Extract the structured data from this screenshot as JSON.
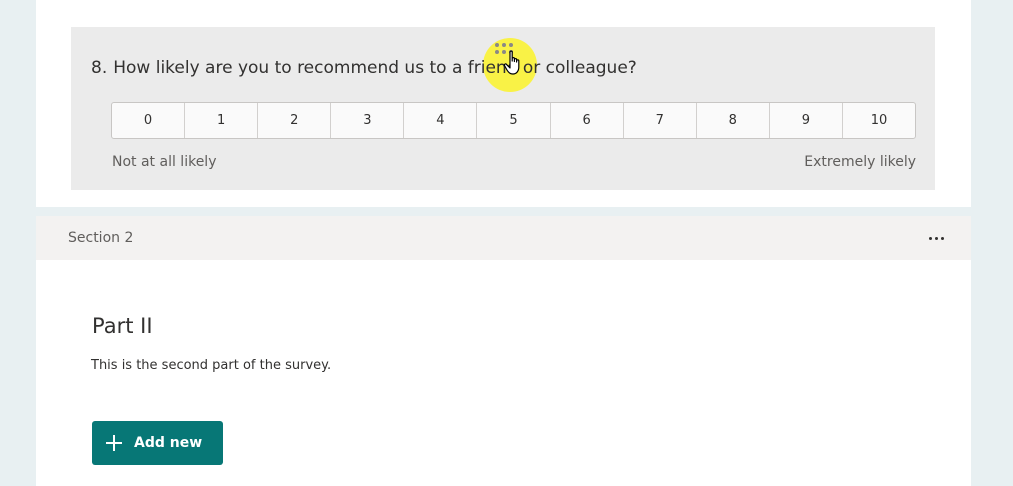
{
  "question": {
    "number": "8.",
    "text": "How likely are you to recommend us to a friend or colleague?",
    "scale": [
      "0",
      "1",
      "2",
      "3",
      "4",
      "5",
      "6",
      "7",
      "8",
      "9",
      "10"
    ],
    "low_label": "Not at all likely",
    "high_label": "Extremely likely"
  },
  "section": {
    "label": "Section 2",
    "title": "Part II",
    "description": "This is the second part of the survey."
  },
  "actions": {
    "add_new_label": "Add new"
  },
  "colors": {
    "accent": "#077776",
    "cursor_highlight": "#fff500"
  }
}
